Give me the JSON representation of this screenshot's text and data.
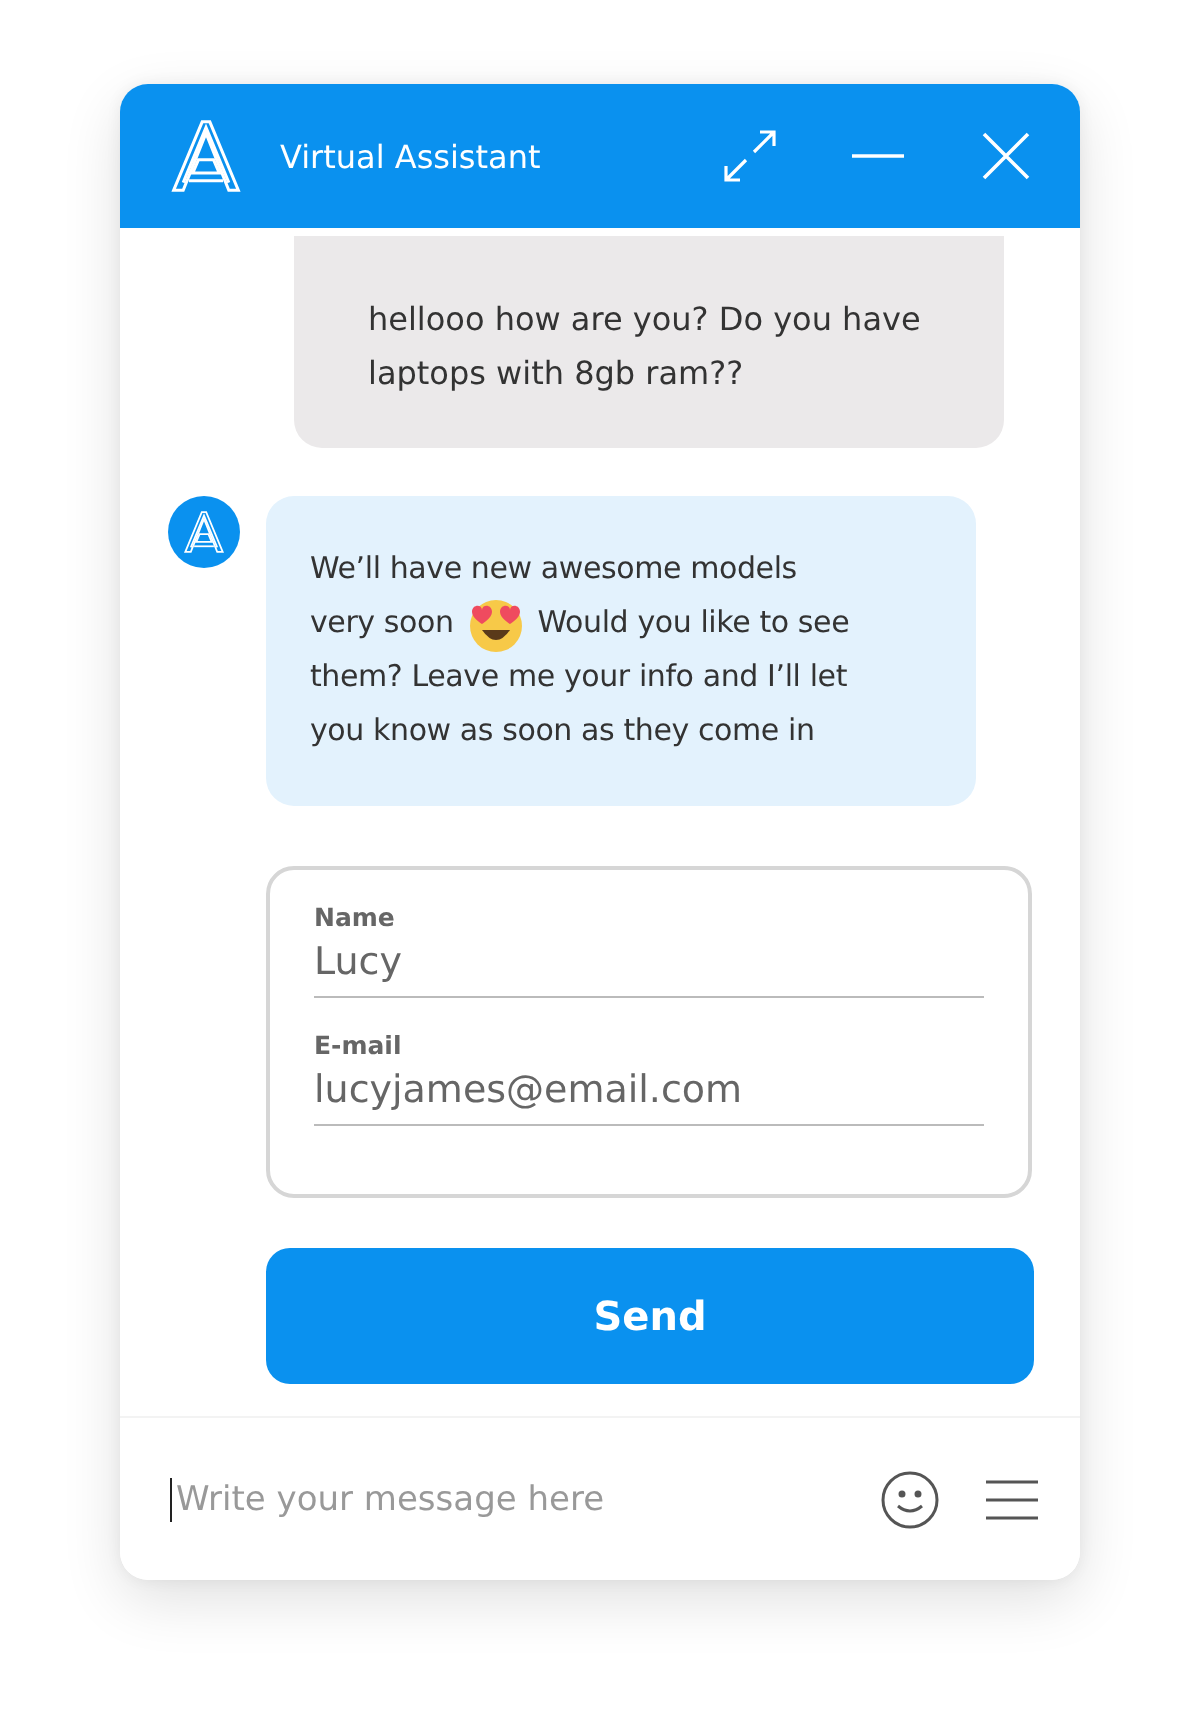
{
  "window": {
    "title": "Virtual Assistant"
  },
  "messages": [
    {
      "kind": "user",
      "text": "hellooo how are you? Do you have laptops with 8gb ram??"
    },
    {
      "kind": "bot",
      "lines": [
        {
          "kind": "text",
          "text": "We’ll have new awesome models"
        },
        {
          "kind": "emoji",
          "before": "very soon",
          "after": "Would you like to see"
        },
        {
          "kind": "text",
          "text": "them? Leave me your info and I’ll let"
        },
        {
          "kind": "text",
          "text": "you know as soon as they come in"
        }
      ]
    }
  ],
  "form": {
    "fields": [
      {
        "label": "Name",
        "value": "Lucy"
      },
      {
        "label": "E-mail",
        "value": "lucyjames@email.com"
      }
    ],
    "button": "Send"
  },
  "composer": {
    "placeholder": "Write your message here"
  }
}
